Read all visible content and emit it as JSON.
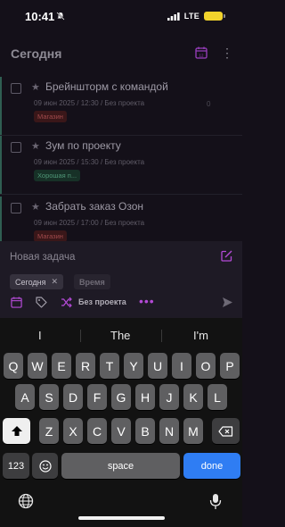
{
  "status": {
    "time": "10:41",
    "network": "LTE"
  },
  "header": {
    "title": "Сегодня"
  },
  "tasks": [
    {
      "title": "Брейншторм с командой",
      "meta": "09 июн 2025 / 12:30 / Без проекта",
      "tag": "Магазин",
      "tag_color": "red",
      "count": "0"
    },
    {
      "title": "Зум по проекту",
      "meta": "09 июн 2025 / 15:30 / Без проекта",
      "tag": "Хорошая п...",
      "tag_color": "green",
      "count": ""
    },
    {
      "title": "Забрать заказ Озон",
      "meta": "09 июн 2025 / 17:00 / Без проекта",
      "tag": "Магазин",
      "tag_color": "red",
      "count": ""
    }
  ],
  "composer": {
    "placeholder": "Новая задача",
    "chip_today": "Сегодня",
    "chip_time": "Время",
    "project": "Без проекта",
    "more": "•••"
  },
  "keyboard": {
    "suggestions": [
      "I",
      "The",
      "I'm"
    ],
    "row1": [
      "Q",
      "W",
      "E",
      "R",
      "T",
      "Y",
      "U",
      "I",
      "O",
      "P"
    ],
    "row2": [
      "A",
      "S",
      "D",
      "F",
      "G",
      "H",
      "J",
      "K",
      "L"
    ],
    "row3": [
      "Z",
      "X",
      "C",
      "V",
      "B",
      "N",
      "M"
    ],
    "num_key": "123",
    "space_key": "space",
    "done_key": "done"
  },
  "colors": {
    "accent": "#b34ad6",
    "done_key": "#2f7df3",
    "battery": "#f2d32c"
  },
  "icons": [
    "bell-slash-icon",
    "signal-icon",
    "battery-icon",
    "calendar-icon",
    "kebab-icon",
    "star-icon",
    "edit-icon",
    "close-icon",
    "tag-icon",
    "shuffle-icon",
    "send-icon",
    "shift-icon",
    "backspace-icon",
    "emoji-icon",
    "globe-icon",
    "mic-icon"
  ]
}
